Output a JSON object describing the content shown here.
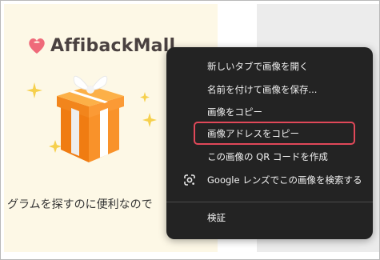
{
  "page": {
    "brand": "AffibackMall",
    "promo_text": "グラムを探すのに便利なので"
  },
  "context_menu": {
    "items": [
      {
        "label": "新しいタブで画像を開く",
        "icon": null
      },
      {
        "label": "名前を付けて画像を保存...",
        "icon": null
      },
      {
        "label": "画像をコピー",
        "icon": null
      },
      {
        "label": "画像アドレスをコピー",
        "icon": null,
        "highlighted": true
      },
      {
        "label": "この画像の QR コードを作成",
        "icon": null
      },
      {
        "label": "Google レンズでこの画像を検索する",
        "icon": "google-lens-icon"
      },
      {
        "label": "検証",
        "icon": null
      }
    ]
  },
  "colors": {
    "menu_background": "#232323",
    "menu_text": "#f2f2f2",
    "highlight_border": "#e04859",
    "banner_background": "#fdf8e6",
    "gift_orange": "#f7901e"
  }
}
